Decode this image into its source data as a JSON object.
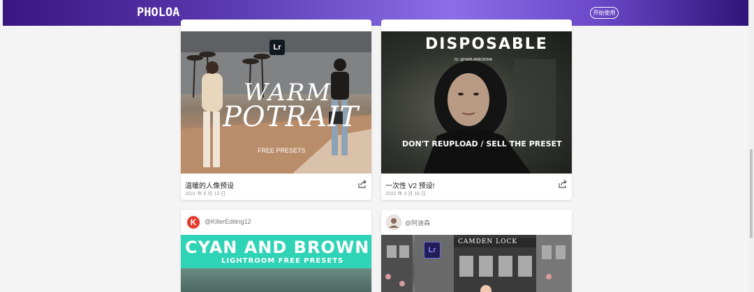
{
  "header": {
    "logo_text": "PHOLOA",
    "start_button": "开始使用"
  },
  "cards": [
    {
      "title": "温暖的人像预设",
      "date": "2021 年 6 月 13 日",
      "image_text": {
        "badge": "Lr",
        "line1": "WARM",
        "line2": "POTRAIT",
        "line3": "FREE PRESETS"
      }
    },
    {
      "title": "一次性 V2 预设!",
      "date": "2022 年 3 月 16 日",
      "image_text": {
        "headline": "DISPOSABLE",
        "handle": "IG: @HAMLAWEDIONA",
        "footer": "DON'T REUPLOAD / SELL THE PRESET"
      }
    },
    {
      "author": "@KillerEditing12",
      "avatar_letter": "K",
      "image_text": {
        "line1": "CYAN AND BROWN",
        "line2": "LIGHTROOM FREE PRESETS"
      }
    },
    {
      "author": "@阿迪森",
      "image_text": {
        "badge": "Lr",
        "sign": "CAMDEN LOCK"
      }
    }
  ],
  "colors": {
    "header_gradient_start": "#3a1580",
    "header_gradient_mid": "#8b6ee8",
    "cyan_banner": "#2fd3b6",
    "killer_avatar": "#e23b2e"
  }
}
